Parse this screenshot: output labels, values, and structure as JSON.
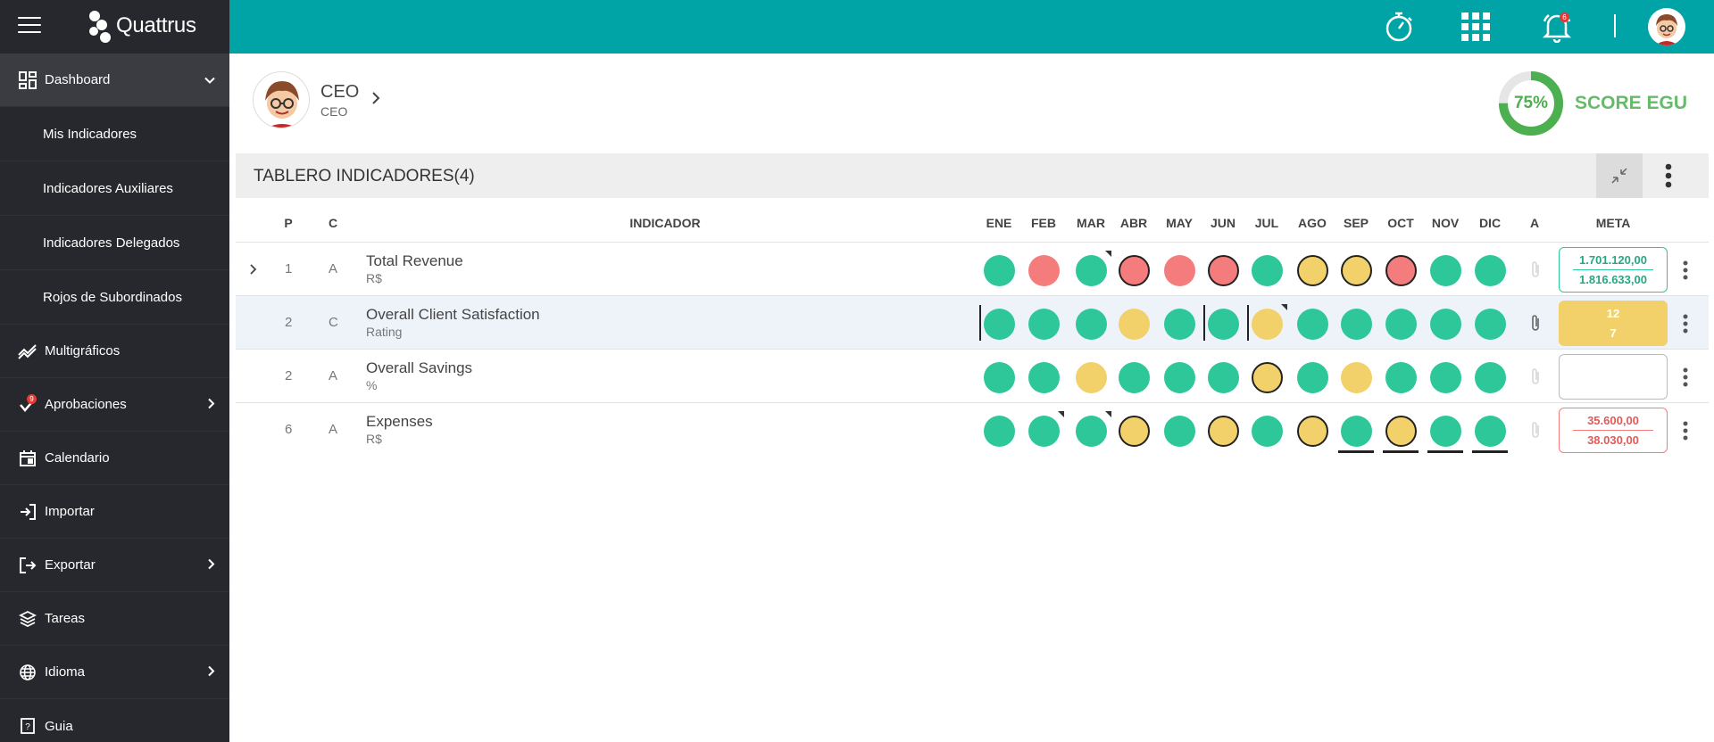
{
  "sidebar": {
    "logo_text": "Quattrus",
    "items": [
      {
        "label": "Dashboard",
        "icon": "dashboard-icon"
      },
      {
        "label": "Mis Indicadores"
      },
      {
        "label": "Indicadores Auxiliares"
      },
      {
        "label": "Indicadores Delegados"
      },
      {
        "label": "Rojos de Subordinados"
      },
      {
        "label": "Multigráficos",
        "icon": "chart-line-icon"
      },
      {
        "label": "Aprobaciones",
        "icon": "check-icon",
        "badge": "9"
      },
      {
        "label": "Calendario",
        "icon": "calendar-icon"
      },
      {
        "label": "Importar",
        "icon": "import-icon"
      },
      {
        "label": "Exportar",
        "icon": "export-icon"
      },
      {
        "label": "Tareas",
        "icon": "layers-icon"
      },
      {
        "label": "Idioma",
        "icon": "globe-icon"
      },
      {
        "label": "Guia",
        "icon": "help-icon"
      }
    ]
  },
  "topbar": {
    "notification_count": "6",
    "accent": "#00a3a6"
  },
  "profile": {
    "name": "CEO",
    "role": "CEO"
  },
  "score": {
    "percent": "75%",
    "value": 0.75,
    "label": "SCORE EGU"
  },
  "panel": {
    "title": "TABLERO INDICADORES(4)"
  },
  "table": {
    "headers": {
      "p": "P",
      "c": "C",
      "indicator": "INDICADOR",
      "months": [
        "ENE",
        "FEB",
        "MAR",
        "ABR",
        "MAY",
        "JUN",
        "JUL",
        "AGO",
        "SEP",
        "OCT",
        "NOV",
        "DIC"
      ],
      "a": "A",
      "meta": "META"
    },
    "rows": [
      {
        "p": "1",
        "c": "A",
        "name": "Total Revenue",
        "unit": "R$",
        "meta_top": "1.701.120,00",
        "meta_bottom": "1.816.633,00"
      },
      {
        "p": "2",
        "c": "C",
        "name": "Overall Client Satisfaction",
        "unit": "Rating",
        "meta_top": "12",
        "meta_bottom": "7"
      },
      {
        "p": "2",
        "c": "A",
        "name": "Overall Savings",
        "unit": "%",
        "meta_top": "",
        "meta_bottom": ""
      },
      {
        "p": "6",
        "c": "A",
        "name": "Expenses",
        "unit": "R$",
        "meta_top": "35.600,00",
        "meta_bottom": "38.030,00"
      }
    ]
  }
}
